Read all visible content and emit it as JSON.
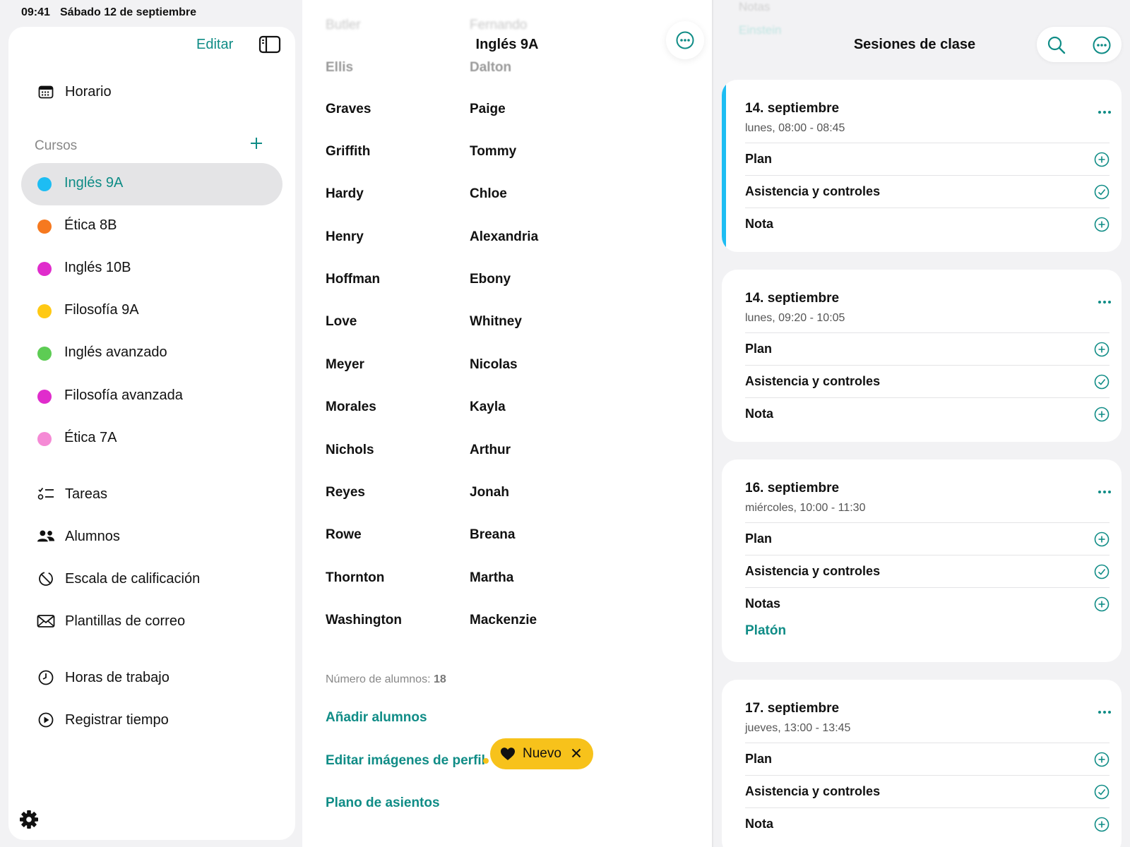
{
  "status": {
    "time": "09:41",
    "date": "Sábado 12 de septiembre"
  },
  "accent": "#0f8c86",
  "sidebar": {
    "edit_label": "Editar",
    "schedule_label": "Horario",
    "courses_header": "Cursos",
    "courses": [
      {
        "label": "Inglés 9A",
        "color": "#1dbdf3",
        "selected": true
      },
      {
        "label": "Ética 8B",
        "color": "#f6791f"
      },
      {
        "label": "Inglés 10B",
        "color": "#e02ccc"
      },
      {
        "label": "Filosofía 9A",
        "color": "#ffc914"
      },
      {
        "label": "Inglés avanzado",
        "color": "#5dcc54"
      },
      {
        "label": "Filosofía avanzada",
        "color": "#e02ccc"
      },
      {
        "label": "Ética 7A",
        "color": "#f58ad5"
      }
    ],
    "tools": [
      {
        "label": "Tareas",
        "icon": "checklist-icon"
      },
      {
        "label": "Alumnos",
        "icon": "people-icon"
      },
      {
        "label": "Escala de calificación",
        "icon": "grade-scale-icon"
      },
      {
        "label": "Plantillas de correo",
        "icon": "envelope-icon"
      }
    ],
    "time_tools": [
      {
        "label": "Horas de trabajo",
        "icon": "clock-icon"
      },
      {
        "label": "Registrar tiempo",
        "icon": "play-circle-icon"
      }
    ]
  },
  "middle": {
    "title": "Inglés 9A",
    "ghost_top": {
      "last": "Butler",
      "first": "Fernando"
    },
    "ghost_second": {
      "last": "Ellis",
      "first": "Dalton"
    },
    "students": [
      {
        "last": "Graves",
        "first": "Paige"
      },
      {
        "last": "Griffith",
        "first": "Tommy"
      },
      {
        "last": "Hardy",
        "first": "Chloe"
      },
      {
        "last": "Henry",
        "first": "Alexandria"
      },
      {
        "last": "Hoffman",
        "first": "Ebony"
      },
      {
        "last": "Love",
        "first": "Whitney"
      },
      {
        "last": "Meyer",
        "first": "Nicolas"
      },
      {
        "last": "Morales",
        "first": "Kayla"
      },
      {
        "last": "Nichols",
        "first": "Arthur"
      },
      {
        "last": "Reyes",
        "first": "Jonah"
      },
      {
        "last": "Rowe",
        "first": "Breana"
      },
      {
        "last": "Thornton",
        "first": "Martha"
      },
      {
        "last": "Washington",
        "first": "Mackenzie"
      }
    ],
    "count_label": "Número de alumnos:",
    "count_value": "18",
    "add_students": "Añadir alumnos",
    "edit_pictures": "Editar imágenes de perfil",
    "seating_plan": "Plano de asientos",
    "new_badge": "Nuevo"
  },
  "right": {
    "title": "Sesiones de clase",
    "ghost": {
      "a": "Notas",
      "b": "Einstein"
    },
    "sessions": [
      {
        "date": "14. septiembre",
        "time": "lunes, 08:00 - 08:45",
        "rows": [
          "Plan",
          "Asistencia y controles",
          "Nota"
        ],
        "current": true
      },
      {
        "date": "14. septiembre",
        "time": "lunes, 09:20 - 10:05",
        "rows": [
          "Plan",
          "Asistencia y controles",
          "Nota"
        ]
      },
      {
        "date": "16. septiembre",
        "time": "miércoles, 10:00 - 11:30",
        "rows": [
          "Plan",
          "Asistencia y controles",
          "Notas"
        ],
        "note_link": "Platón"
      },
      {
        "date": "17. septiembre",
        "time": "jueves, 13:00 - 13:45",
        "rows": [
          "Plan",
          "Asistencia y controles",
          "Nota"
        ]
      }
    ]
  }
}
